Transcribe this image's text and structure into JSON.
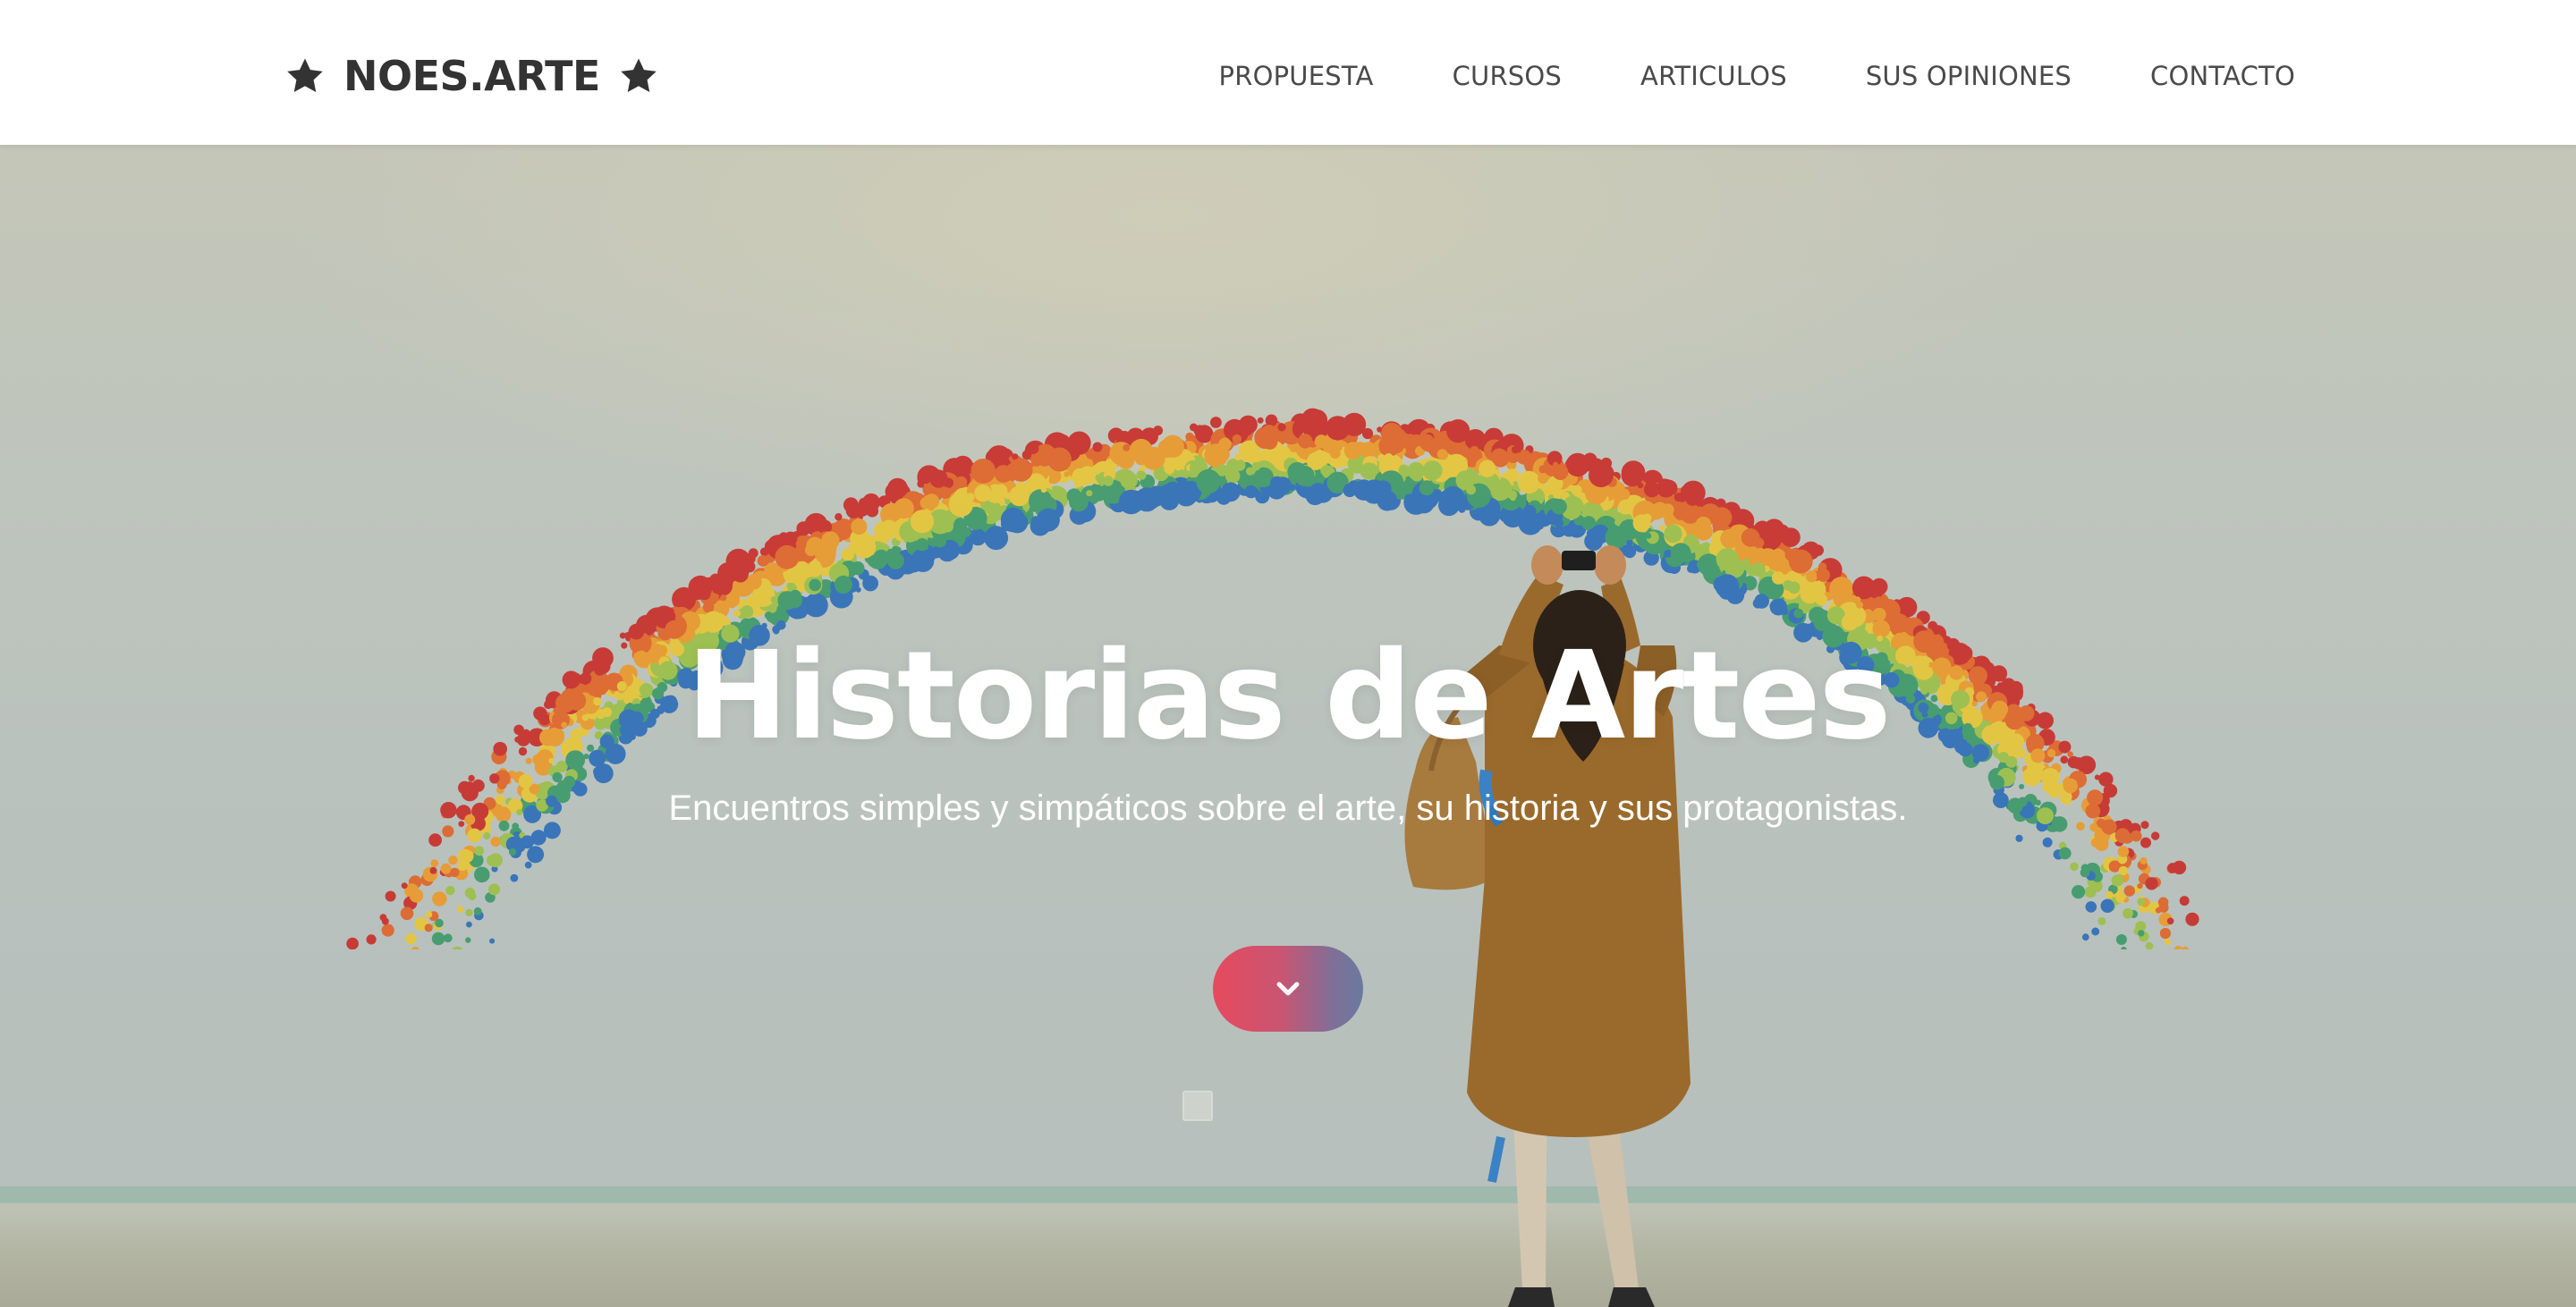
{
  "header": {
    "brand": "NOES.ARTE",
    "brand_left_icon": "star-icon",
    "brand_right_icon": "star-icon",
    "nav": [
      {
        "label": "PROPUESTA"
      },
      {
        "label": "CURSOS"
      },
      {
        "label": "ARTICULOS"
      },
      {
        "label": "SUS OPINIONES"
      },
      {
        "label": "CONTACTO"
      }
    ]
  },
  "hero": {
    "title": "Historias de Artes",
    "subtitle": "Encuentros simples y simpáticos sobre el arte, su historia y sus protagonistas.",
    "scroll_button_icon": "chevron-down-icon",
    "button_gradient": [
      "#e64a5d",
      "#6a7aa0"
    ]
  },
  "colors": {
    "header_bg": "#ffffff",
    "text_dark": "#333333",
    "nav_text": "#4a4a4a",
    "hero_text": "#ffffff"
  }
}
